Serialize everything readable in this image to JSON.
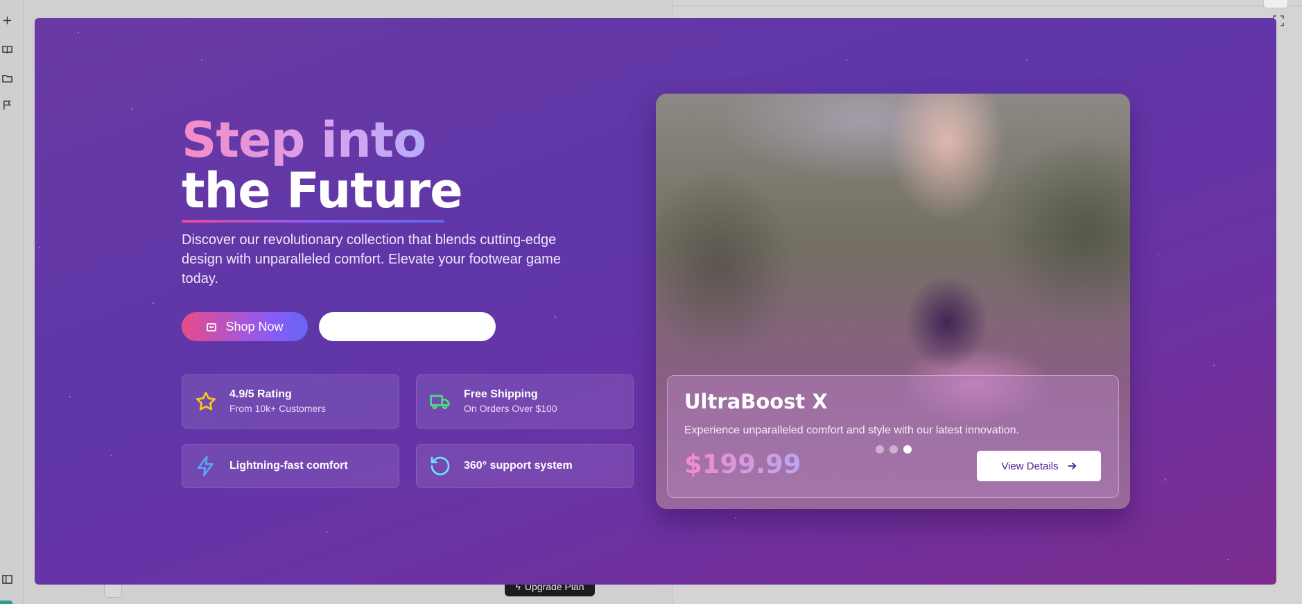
{
  "background": {
    "upgrade_button": {
      "label": "Upgrade Plan"
    }
  },
  "hero": {
    "title_line1": "Step into",
    "title_line2": "the Future",
    "description": "Discover our revolutionary collection that blends cutting-edge design with unparalleled comfort. Elevate your footwear game today.",
    "primary_button": "Shop Now",
    "secondary_button": ""
  },
  "features": [
    {
      "icon": "star-icon",
      "title": "4.9/5 Rating",
      "subtitle": "From 10k+ Customers",
      "color": "#facc15"
    },
    {
      "icon": "truck-icon",
      "title": "Free Shipping",
      "subtitle": "On Orders Over $100",
      "color": "#4ade80"
    },
    {
      "icon": "lightning-icon",
      "title": "Lightning-fast comfort",
      "subtitle": "",
      "color": "#60a5fa"
    },
    {
      "icon": "refresh-icon",
      "title": "360° support system",
      "subtitle": "",
      "color": "#67e8f9"
    }
  ],
  "product": {
    "name": "UltraBoost X",
    "description": "Experience unparalleled comfort and style with our latest innovation.",
    "price": "$199.99",
    "slides_total": 3,
    "active_slide": 3,
    "details_button": "View Details"
  },
  "colors": {
    "accent_pink": "#ec4899",
    "accent_violet": "#8b5cf6",
    "accent_indigo": "#6366f1",
    "modal_bg": "#6334a6"
  }
}
